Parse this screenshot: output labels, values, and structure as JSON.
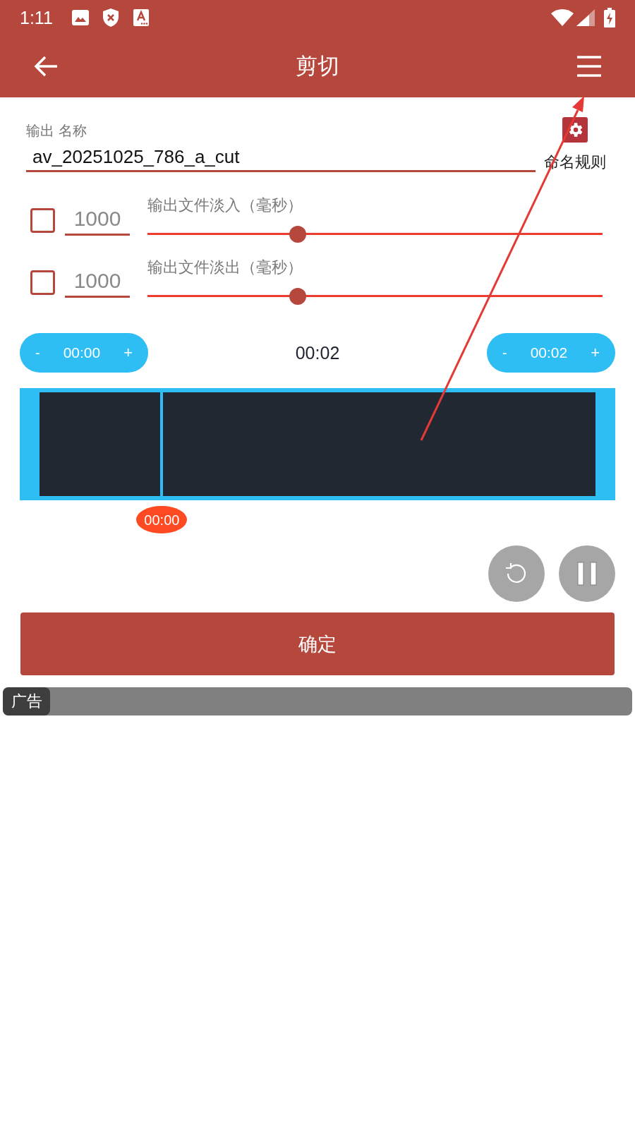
{
  "status_bar": {
    "time": "1:11"
  },
  "toolbar": {
    "title": "剪切"
  },
  "output_name": {
    "label": "输出 名称",
    "value": "av_20251025_786_a_cut"
  },
  "naming_rules": {
    "label": "命名规则"
  },
  "fades": [
    {
      "checked": false,
      "value": "1000",
      "disabled": true,
      "label": "输出文件淡入（毫秒）",
      "level": 0.33
    },
    {
      "checked": false,
      "value": "1000",
      "disabled": true,
      "label": "输出文件淡出（毫秒）",
      "level": 0.33
    }
  ],
  "time_range": {
    "start": {
      "decrement": "-",
      "value": "00:00",
      "increment": "+"
    },
    "duration": "00:02",
    "end": {
      "decrement": "-",
      "value": "00:02",
      "increment": "+"
    }
  },
  "waveform": {
    "playhead": {
      "label": "00:00",
      "level": 0.22
    }
  },
  "confirm_button": {
    "label": "确定"
  },
  "ad": {
    "badge": "广告"
  }
}
